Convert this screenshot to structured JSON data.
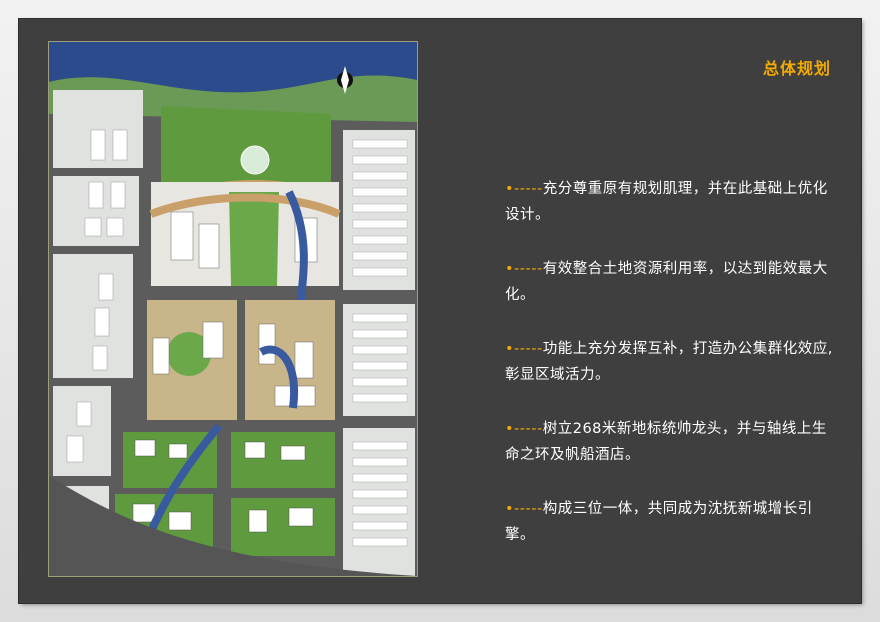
{
  "slide": {
    "title": "总体规划",
    "bullets": [
      {
        "marker": "•-----",
        "text": "充分尊重原有规划肌理，并在此基础上优化设计。"
      },
      {
        "marker": "•-----",
        "text": "有效整合土地资源利用率，以达到能效最大化。"
      },
      {
        "marker": "•-----",
        "text": "功能上充分发挥互补，打造办公集群化效应,彰显区域活力。"
      },
      {
        "marker": "•-----",
        "text": "树立268米新地标统帅龙头，并与轴线上生命之环及帆船酒店。"
      },
      {
        "marker": "•-----",
        "text": "构成三位一体，共同成为沈抚新城增长引擎。"
      }
    ]
  },
  "colors": {
    "accent": "#f2a900",
    "panel": "#3f3f3f",
    "water": "#2a4a8a",
    "park_green": "#5f9a3e",
    "road": "#5a5a5a",
    "block_gray": "#dfe2df",
    "plaza": "#c9a06a"
  },
  "plan_image": {
    "content": "city master plan site map",
    "north_arrow": "north-arrow-icon"
  }
}
